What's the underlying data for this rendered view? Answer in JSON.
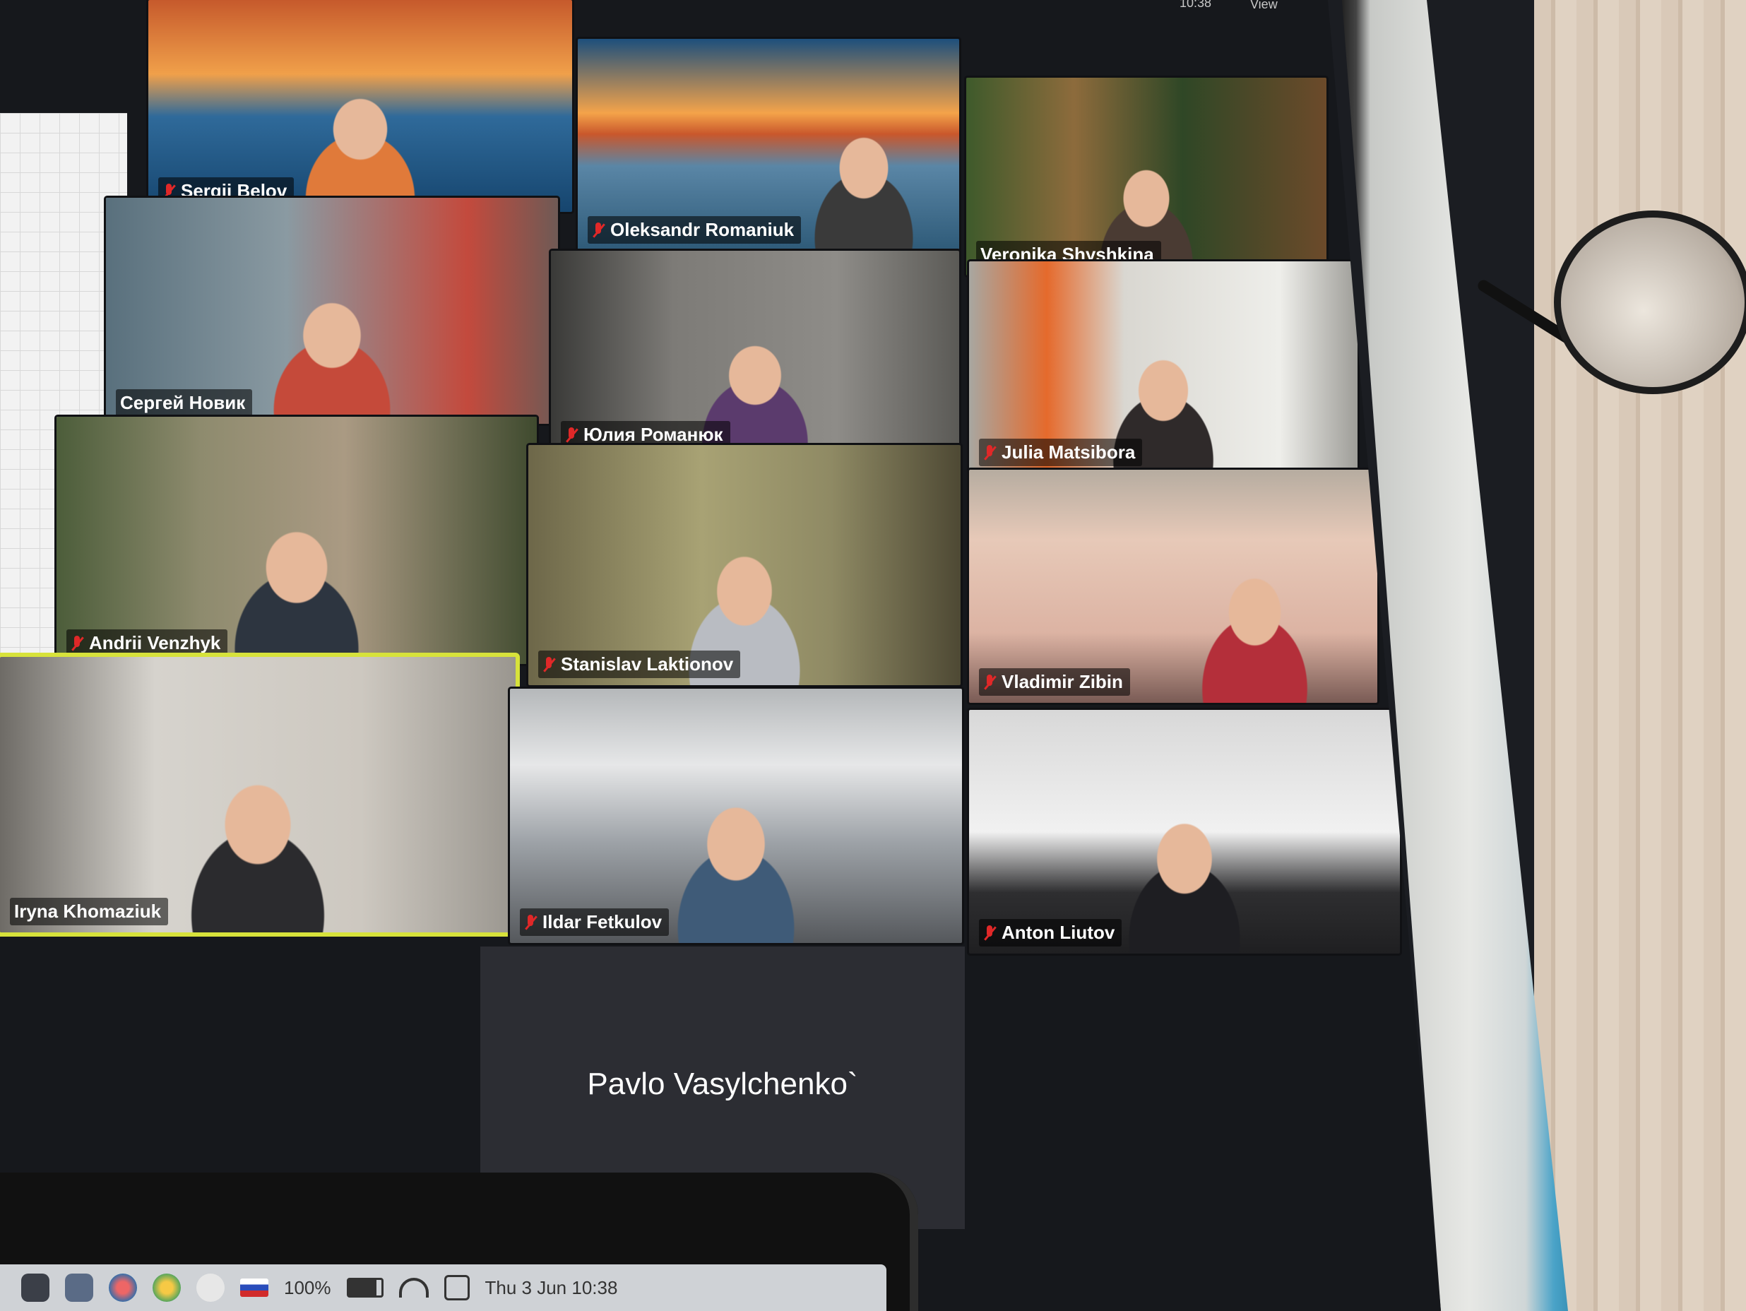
{
  "topbar": {
    "time": "10:38",
    "view_label": "View"
  },
  "participants": [
    {
      "name": "Sergii Belov",
      "muted": true
    },
    {
      "name": "Oleksandr Romaniuk",
      "muted": true
    },
    {
      "name": "Veronika Shyshkina",
      "muted": false
    },
    {
      "name": "Сергей Новик",
      "muted": false
    },
    {
      "name": "Юлия Романюк",
      "muted": true
    },
    {
      "name": "Julia Matsibora",
      "muted": true
    },
    {
      "name": "Andrii Venzhyk",
      "muted": true
    },
    {
      "name": "Stanislav Laktionov",
      "muted": true
    },
    {
      "name": "Vladimir Zibin",
      "muted": true
    },
    {
      "name": "Iryna Khomaziuk",
      "muted": false,
      "active_speaker": true
    },
    {
      "name": "Ildar Fetkulov",
      "muted": true
    },
    {
      "name": "Anton Liutov",
      "muted": true
    }
  ],
  "video_off_participant": {
    "name": "Pavlo Vasylchenko`"
  },
  "menubar": {
    "battery": "100%",
    "datetime": "Thu 3 Jun  10:38"
  },
  "colors": {
    "active_speaker_border": "#d7e23b",
    "mute_icon": "#e02828",
    "tile_bg": "#2c2d33"
  }
}
